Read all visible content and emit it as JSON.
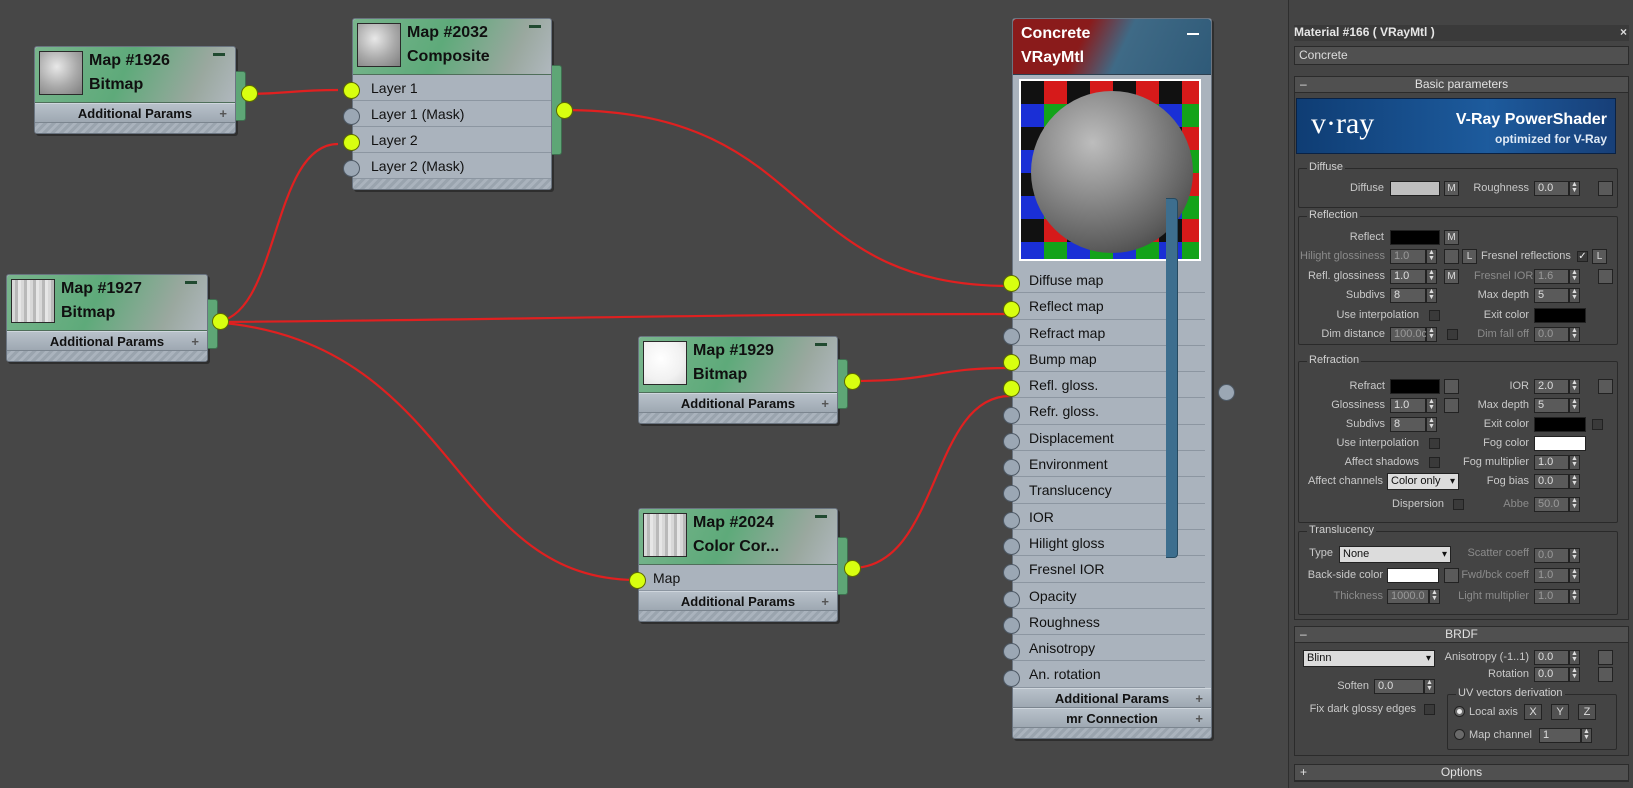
{
  "nodes": {
    "map1926": {
      "title": "Map #1926",
      "type": "Bitmap",
      "params": "Additional Params"
    },
    "map2032": {
      "title": "Map #2032",
      "type": "Composite",
      "slots": [
        "Layer 1",
        "Layer 1 (Mask)",
        "Layer 2",
        "Layer 2 (Mask)"
      ]
    },
    "map1927": {
      "title": "Map #1927",
      "type": "Bitmap",
      "params": "Additional Params"
    },
    "map1929": {
      "title": "Map #1929",
      "type": "Bitmap",
      "params": "Additional Params"
    },
    "map2024": {
      "title": "Map #2024",
      "type": "Color  Cor...",
      "slot": "Map",
      "params": "Additional Params"
    },
    "material": {
      "title": "Concrete",
      "type": "VRayMtl",
      "slots": [
        "Diffuse map",
        "Reflect map",
        "Refract map",
        "Bump map",
        "Refl. gloss.",
        "Refr. gloss.",
        "Displacement",
        "Environment",
        "Translucency",
        "IOR",
        "Hilight gloss",
        "Fresnel IOR",
        "Opacity",
        "Roughness",
        "Anisotropy",
        "An. rotation"
      ],
      "connected": [
        true,
        true,
        false,
        true,
        true,
        false,
        false,
        false,
        false,
        false,
        false,
        false,
        false,
        false,
        false,
        false
      ],
      "bars": [
        "Additional Params",
        "mr Connection"
      ]
    }
  },
  "panel": {
    "title": "Material #166  ( VRayMtl )",
    "close": "×",
    "name": "Concrete",
    "basic_header": "Basic parameters",
    "banner": {
      "logo": "v·ray",
      "line1": "V-Ray PowerShader",
      "line2": "optimized for V-Ray"
    },
    "diffuse": {
      "group": "Diffuse",
      "diffuse_label": "Diffuse",
      "m": "M",
      "roughness_label": "Roughness",
      "roughness": "0.0",
      "color": "#bfbfbf"
    },
    "reflection": {
      "group": "Reflection",
      "reflect_label": "Reflect",
      "m": "M",
      "hilight_label": "Hilight glossiness",
      "hilight": "1.0",
      "l": "L",
      "fresnel_label": "Fresnel reflections",
      "fresnel_check": "✓",
      "refl_gloss_label": "Refl. glossiness",
      "refl_gloss": "1.0",
      "fresnel_ior_label": "Fresnel IOR",
      "fresnel_ior": "1.6",
      "subdivs_label": "Subdivs",
      "subdivs": "8",
      "max_depth_label": "Max depth",
      "max_depth": "5",
      "use_interp_label": "Use interpolation",
      "exit_color_label": "Exit color",
      "dim_distance_label": "Dim distance",
      "dim_distance": "100.0c",
      "dim_falloff_label": "Dim fall off",
      "dim_falloff": "0.0"
    },
    "refraction": {
      "group": "Refraction",
      "refract_label": "Refract",
      "ior_label": "IOR",
      "ior": "2.0",
      "glossiness_label": "Glossiness",
      "glossiness": "1.0",
      "max_depth_label": "Max depth",
      "max_depth": "5",
      "subdivs_label": "Subdivs",
      "subdivs": "8",
      "exit_color_label": "Exit color",
      "use_interp_label": "Use interpolation",
      "fog_color_label": "Fog color",
      "affect_shadows_label": "Affect shadows",
      "fog_mult_label": "Fog multiplier",
      "fog_mult": "1.0",
      "affect_channels_label": "Affect channels",
      "affect_channels": "Color only",
      "fog_bias_label": "Fog bias",
      "fog_bias": "0.0",
      "dispersion_label": "Dispersion",
      "abbe_label": "Abbe",
      "abbe": "50.0"
    },
    "translucency": {
      "group": "Translucency",
      "type_label": "Type",
      "type": "None",
      "scatter_label": "Scatter coeff",
      "scatter": "0.0",
      "backside_label": "Back-side color",
      "fwdbck_label": "Fwd/bck coeff",
      "fwdbck": "1.0",
      "thickness_label": "Thickness",
      "thickness": "1000.0",
      "light_mult_label": "Light multiplier",
      "light_mult": "1.0"
    },
    "brdf": {
      "header": "BRDF",
      "type": "Blinn",
      "aniso_label": "Anisotropy (-1..1)",
      "aniso": "0.0",
      "rotation_label": "Rotation",
      "rotation": "0.0",
      "soften_label": "Soften",
      "soften": "0.0",
      "uv_group": "UV vectors derivation",
      "fix_dark_label": "Fix dark glossy edges",
      "local_axis_label": "Local axis",
      "x": "X",
      "y": "Y",
      "z": "Z",
      "map_channel_label": "Map channel",
      "map_channel": "1"
    },
    "options_header": "Options"
  },
  "colors": {
    "wire": "#e02020",
    "port_on": "#d8ff10",
    "port_off": "#9ba7b4",
    "node_header": "#5eaa7a",
    "material_header": "#8a1b1b"
  }
}
